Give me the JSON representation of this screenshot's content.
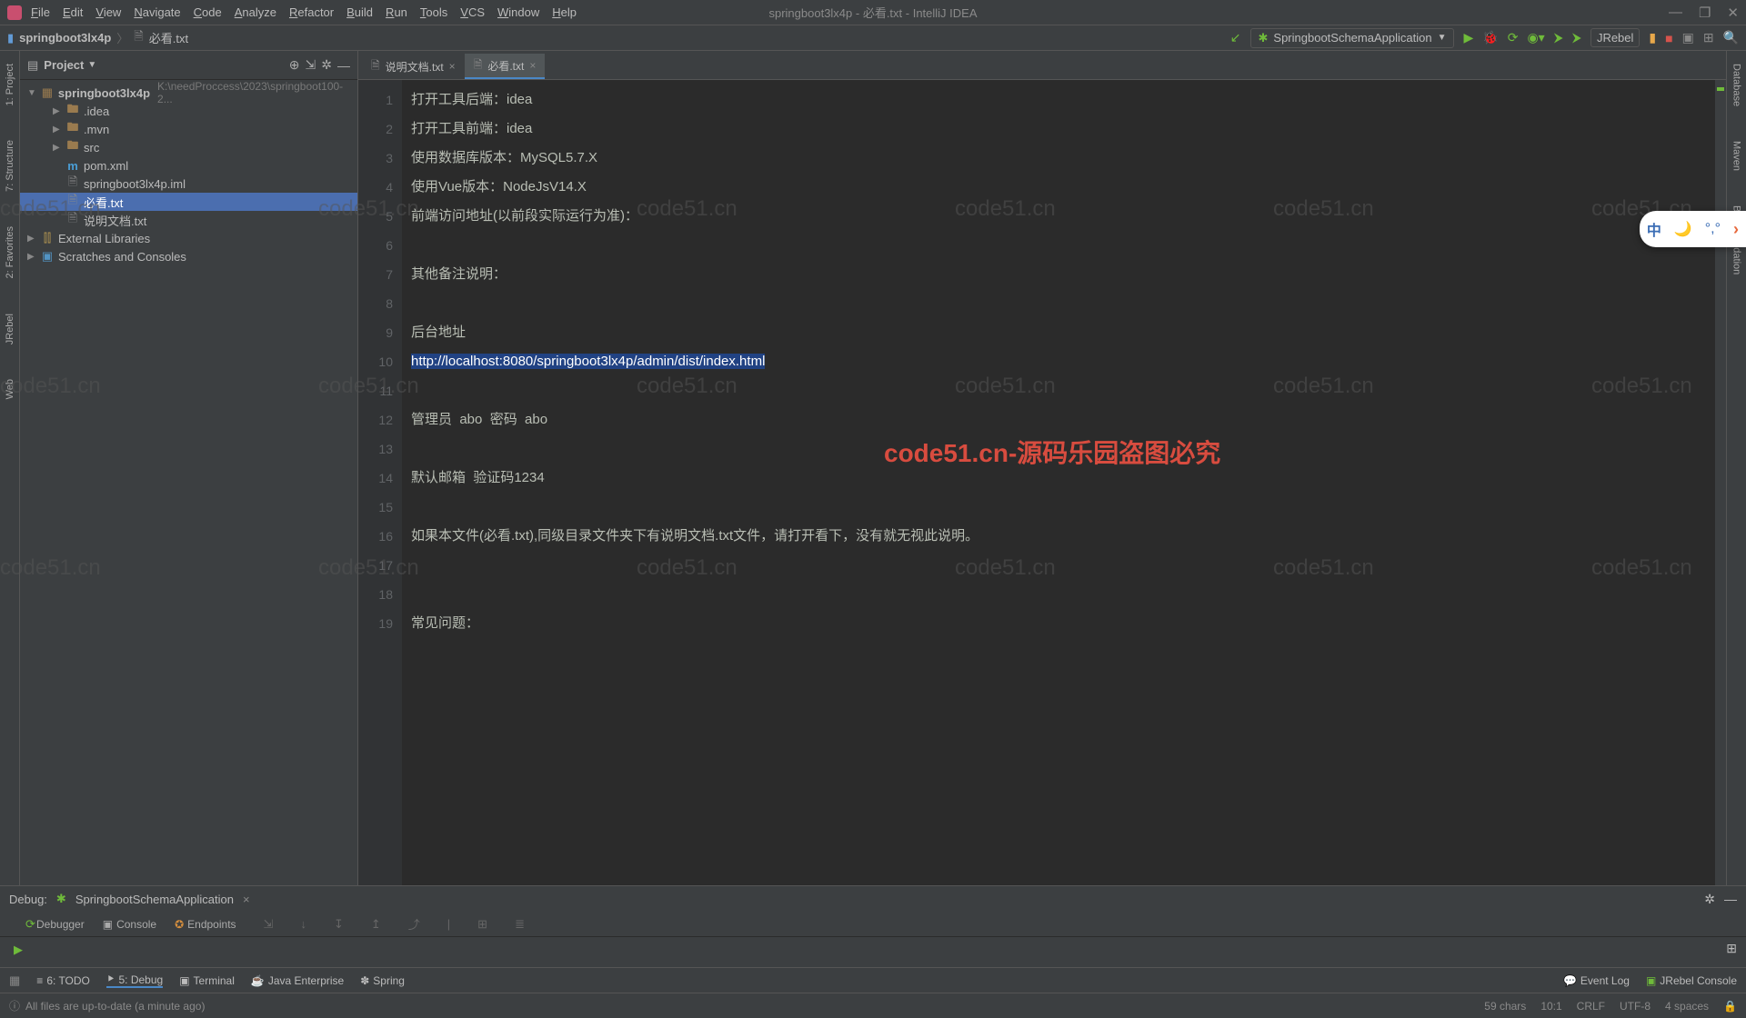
{
  "menus": [
    "File",
    "Edit",
    "View",
    "Navigate",
    "Code",
    "Analyze",
    "Refactor",
    "Build",
    "Run",
    "Tools",
    "VCS",
    "Window",
    "Help"
  ],
  "window_title": "springboot3lx4p - 必看.txt - IntelliJ IDEA",
  "breadcrumb": {
    "root": "springboot3lx4p",
    "file": "必看.txt"
  },
  "run_config": {
    "name": "SpringbootSchemaApplication"
  },
  "run_btn_right": "JRebel",
  "left_tabs": [
    "1: Project",
    "7: Structure",
    "2: Favorites",
    "JRebel",
    "Web"
  ],
  "right_tabs": [
    "Database",
    "Maven",
    "Bean Validation"
  ],
  "project_panel": {
    "title": "Project",
    "root": {
      "name": "springboot3lx4p",
      "path": "K:\\needProccess\\2023\\springboot100-2..."
    },
    "items": [
      {
        "indent": 2,
        "arrow": "▶",
        "ico": "folder",
        "label": ".idea"
      },
      {
        "indent": 2,
        "arrow": "▶",
        "ico": "folder",
        "label": ".mvn"
      },
      {
        "indent": 2,
        "arrow": "▶",
        "ico": "folder",
        "label": "src"
      },
      {
        "indent": 2,
        "arrow": "",
        "ico": "m",
        "label": "pom.xml"
      },
      {
        "indent": 2,
        "arrow": "",
        "ico": "file",
        "label": "springboot3lx4p.iml"
      },
      {
        "indent": 2,
        "arrow": "",
        "ico": "file",
        "label": "必看.txt",
        "selected": true
      },
      {
        "indent": 2,
        "arrow": "",
        "ico": "file",
        "label": "说明文档.txt"
      }
    ],
    "ext_lib": "External Libraries",
    "scratches": "Scratches and Consoles"
  },
  "editor_tabs": [
    {
      "label": "说明文档.txt",
      "active": false
    },
    {
      "label": "必看.txt",
      "active": true
    }
  ],
  "code_lines": [
    "打开工具后端：idea",
    "打开工具前端：idea",
    "使用数据库版本：MySQL5.7.X",
    "使用Vue版本：NodeJsV14.X",
    "前端访问地址(以前段实际运行为准)：",
    "",
    "其他备注说明：",
    "",
    "后台地址",
    "http://localhost:8080/springboot3lx4p/admin/dist/index.html",
    "",
    "管理员  abo  密码  abo",
    "",
    "默认邮箱  验证码1234",
    "",
    "如果本文件(必看.txt),同级目录文件夹下有说明文档.txt文件，请打开看下，没有就无视此说明。",
    "",
    "",
    "常见问题："
  ],
  "selected_line_index": 9,
  "center_watermark": "code51.cn-源码乐园盗图必究",
  "float_pill": {
    "lang": "中",
    "moon": "🌙",
    "dots": "°,°"
  },
  "debug": {
    "title": "Debug:",
    "app": "SpringbootSchemaApplication",
    "tabs": [
      "Debugger",
      "Console",
      "Endpoints"
    ]
  },
  "bottom_tools": [
    {
      "ico": "≡",
      "label": "6: TODO"
    },
    {
      "ico": "⯈",
      "label": "5: Debug",
      "active": true
    },
    {
      "ico": "▣",
      "label": "Terminal"
    },
    {
      "ico": "☕",
      "label": "Java Enterprise"
    },
    {
      "ico": "✽",
      "label": "Spring"
    }
  ],
  "bottom_right": [
    "Event Log",
    "JRebel Console"
  ],
  "status": {
    "msg": "All files are up-to-date (a minute ago)",
    "right": [
      "59 chars",
      "10:1",
      "CRLF",
      "UTF-8",
      "4 spaces"
    ]
  }
}
